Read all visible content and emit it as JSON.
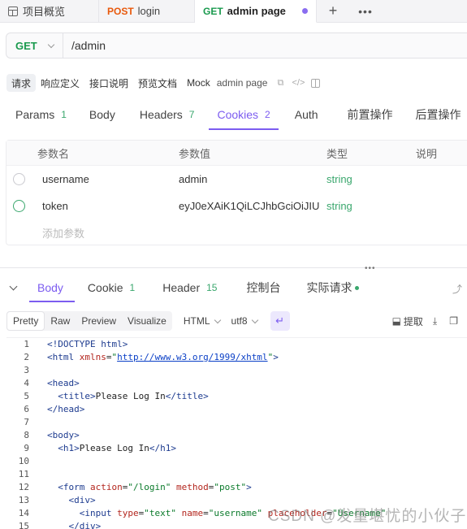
{
  "tabs": [
    {
      "label": "项目概览"
    },
    {
      "method": "POST",
      "label": "login"
    },
    {
      "method": "GET",
      "label": "admin page"
    }
  ],
  "request": {
    "method": "GET",
    "path": "/admin"
  },
  "subnav": {
    "items": [
      "请求",
      "响应定义",
      "接口说明",
      "预览文档",
      "Mock"
    ],
    "name": "admin page"
  },
  "param_tabs": [
    {
      "label": "Params",
      "count": "1"
    },
    {
      "label": "Body",
      "count": ""
    },
    {
      "label": "Headers",
      "count": "7"
    },
    {
      "label": "Cookies",
      "count": "2"
    },
    {
      "label": "Auth",
      "count": ""
    },
    {
      "label": "前置操作",
      "count": ""
    },
    {
      "label": "后置操作",
      "count": ""
    }
  ],
  "cookies": {
    "columns": [
      "参数名",
      "参数值",
      "类型",
      "说明"
    ],
    "rows": [
      {
        "name": "username",
        "value": "admin",
        "type": "string"
      },
      {
        "name": "token",
        "value": "eyJ0eXAiK1QiLCJhbGciOiJIU",
        "type": "string"
      }
    ],
    "add_placeholder": "添加参数"
  },
  "response_tabs": [
    {
      "label": "Body",
      "count": ""
    },
    {
      "label": "Cookie",
      "count": "1"
    },
    {
      "label": "Header",
      "count": "15"
    },
    {
      "label": "控制台",
      "count": ""
    },
    {
      "label": "实际请求",
      "count": ""
    }
  ],
  "format": {
    "modes": [
      "Pretty",
      "Raw",
      "Preview",
      "Visualize"
    ],
    "language": "HTML",
    "encoding": "utf8",
    "extract_label": "提取"
  },
  "code_lines": [
    {
      "n": "1",
      "text": "<!DOCTYPE html>"
    },
    {
      "n": "2",
      "text": "<html xmlns=\"http://www.w3.org/1999/xhtml\">"
    },
    {
      "n": "3",
      "text": ""
    },
    {
      "n": "4",
      "text": "<head>"
    },
    {
      "n": "5",
      "text": "  <title>Please Log In</title>"
    },
    {
      "n": "6",
      "text": "</head>"
    },
    {
      "n": "7",
      "text": ""
    },
    {
      "n": "8",
      "text": "<body>"
    },
    {
      "n": "9",
      "text": "  <h1>Please Log In</h1>"
    },
    {
      "n": "10",
      "text": ""
    },
    {
      "n": "11",
      "text": ""
    },
    {
      "n": "12",
      "text": "  <form action=\"/login\" method=\"post\">"
    },
    {
      "n": "13",
      "text": "    <div>"
    },
    {
      "n": "14",
      "text": "      <input type=\"text\" name=\"username\" placeholder=\"Username\""
    },
    {
      "n": "15",
      "text": "    </div>"
    }
  ],
  "watermark": "CSDN @发量堪忧的小伙子",
  "colors": {
    "accent": "#7c5cf0",
    "get": "#1a9a4e",
    "post": "#e8590c",
    "type": "#3aa76d"
  }
}
